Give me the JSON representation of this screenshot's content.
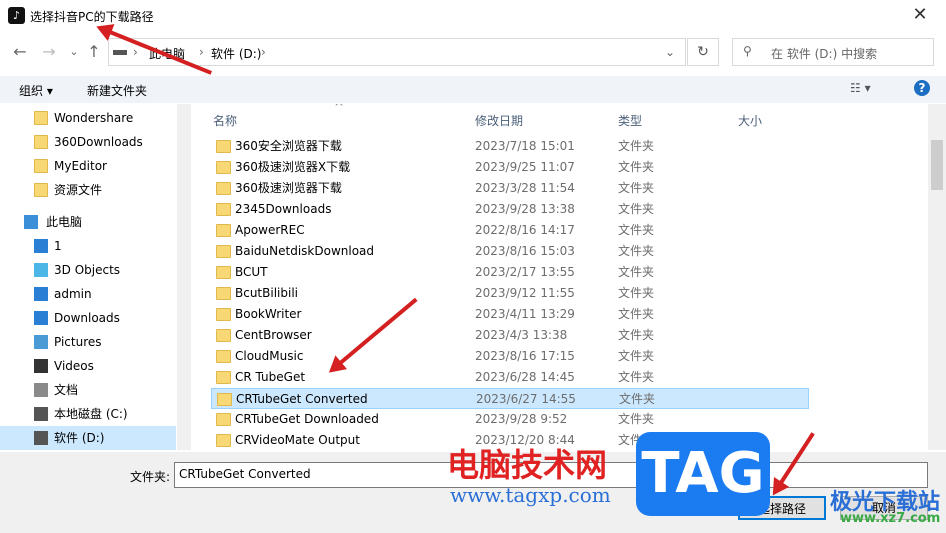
{
  "window": {
    "title": "选择抖音PC的下载路径",
    "close": "✕"
  },
  "nav": {
    "back": "←",
    "forward": "→",
    "recent": "⌄",
    "up": "↑",
    "breadcrumb": [
      "此电脑",
      "软件 (D:)"
    ],
    "refresh": "↻",
    "search_placeholder": "在 软件 (D:) 中搜索"
  },
  "toolbar": {
    "organize": "组织 ▾",
    "new_folder": "新建文件夹",
    "help": "?"
  },
  "sidebar": {
    "items": [
      {
        "label": "Wondershare",
        "icon": "folder-icon"
      },
      {
        "label": "360Downloads",
        "icon": "folder-icon"
      },
      {
        "label": "MyEditor",
        "icon": "folder-icon"
      },
      {
        "label": "资源文件",
        "icon": "folder-icon"
      },
      {
        "label": "此电脑",
        "icon": "computer-icon"
      },
      {
        "label": "1",
        "icon": "music-icon"
      },
      {
        "label": "3D Objects",
        "icon": "cube-icon"
      },
      {
        "label": "admin",
        "icon": "desktop-icon"
      },
      {
        "label": "Downloads",
        "icon": "download-icon"
      },
      {
        "label": "Pictures",
        "icon": "pictures-icon"
      },
      {
        "label": "Videos",
        "icon": "video-icon"
      },
      {
        "label": "文档",
        "icon": "document-icon"
      },
      {
        "label": "本地磁盘 (C:)",
        "icon": "drive-icon"
      },
      {
        "label": "软件 (D:)",
        "icon": "drive-icon",
        "selected": true
      }
    ]
  },
  "columns": [
    "名称",
    "修改日期",
    "类型",
    "大小"
  ],
  "files": [
    {
      "name": "360安全浏览器下载",
      "date": "2023/7/18 15:01",
      "type": "文件夹"
    },
    {
      "name": "360极速浏览器X下载",
      "date": "2023/9/25 11:07",
      "type": "文件夹"
    },
    {
      "name": "360极速浏览器下载",
      "date": "2023/3/28 11:54",
      "type": "文件夹"
    },
    {
      "name": "2345Downloads",
      "date": "2023/9/28 13:38",
      "type": "文件夹"
    },
    {
      "name": "ApowerREC",
      "date": "2022/8/16 14:17",
      "type": "文件夹"
    },
    {
      "name": "BaiduNetdiskDownload",
      "date": "2023/8/16 15:03",
      "type": "文件夹"
    },
    {
      "name": "BCUT",
      "date": "2023/2/17 13:55",
      "type": "文件夹"
    },
    {
      "name": "BcutBilibili",
      "date": "2023/9/12 11:55",
      "type": "文件夹"
    },
    {
      "name": "BookWriter",
      "date": "2023/4/11 13:29",
      "type": "文件夹"
    },
    {
      "name": "CentBrowser",
      "date": "2023/4/3 13:38",
      "type": "文件夹"
    },
    {
      "name": "CloudMusic",
      "date": "2023/8/16 17:15",
      "type": "文件夹"
    },
    {
      "name": "CR TubeGet",
      "date": "2023/6/28 14:45",
      "type": "文件夹"
    },
    {
      "name": "CRTubeGet Converted",
      "date": "2023/6/27 14:55",
      "type": "文件夹",
      "selected": true
    },
    {
      "name": "CRTubeGet Downloaded",
      "date": "2023/9/28 9:52",
      "type": "文件夹"
    },
    {
      "name": "CRVideoMate Output",
      "date": "2023/12/20 8:44",
      "type": "文件夹"
    }
  ],
  "footer": {
    "filename_label": "文件夹:",
    "filename_value": "CRTubeGet Converted",
    "ok": "选择路径",
    "cancel": "取消"
  },
  "watermarks": {
    "cn": "电脑技术网",
    "url": "www.tagxp.com",
    "tag": "TAG",
    "site2": "极光下载站",
    "url2": "www.xz7.com"
  },
  "colors": {
    "selection": "#cce8ff",
    "accent": "#0078d7",
    "arrow": "#d42020"
  }
}
